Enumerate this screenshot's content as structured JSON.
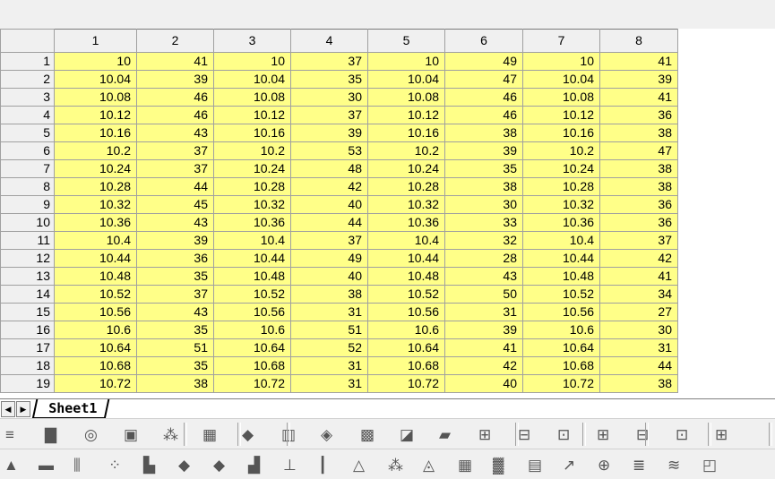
{
  "sheet": {
    "columns": [
      "1",
      "2",
      "3",
      "4",
      "5",
      "6",
      "7",
      "8"
    ],
    "rows": [
      {
        "n": "1",
        "v": [
          "10",
          "41",
          "10",
          "37",
          "10",
          "49",
          "10",
          "41"
        ]
      },
      {
        "n": "2",
        "v": [
          "10.04",
          "39",
          "10.04",
          "35",
          "10.04",
          "47",
          "10.04",
          "39"
        ]
      },
      {
        "n": "3",
        "v": [
          "10.08",
          "46",
          "10.08",
          "30",
          "10.08",
          "46",
          "10.08",
          "41"
        ]
      },
      {
        "n": "4",
        "v": [
          "10.12",
          "46",
          "10.12",
          "37",
          "10.12",
          "46",
          "10.12",
          "36"
        ]
      },
      {
        "n": "5",
        "v": [
          "10.16",
          "43",
          "10.16",
          "39",
          "10.16",
          "38",
          "10.16",
          "38"
        ]
      },
      {
        "n": "6",
        "v": [
          "10.2",
          "37",
          "10.2",
          "53",
          "10.2",
          "39",
          "10.2",
          "47"
        ]
      },
      {
        "n": "7",
        "v": [
          "10.24",
          "37",
          "10.24",
          "48",
          "10.24",
          "35",
          "10.24",
          "38"
        ]
      },
      {
        "n": "8",
        "v": [
          "10.28",
          "44",
          "10.28",
          "42",
          "10.28",
          "38",
          "10.28",
          "38"
        ]
      },
      {
        "n": "9",
        "v": [
          "10.32",
          "45",
          "10.32",
          "40",
          "10.32",
          "30",
          "10.32",
          "36"
        ]
      },
      {
        "n": "10",
        "v": [
          "10.36",
          "43",
          "10.36",
          "44",
          "10.36",
          "33",
          "10.36",
          "36"
        ]
      },
      {
        "n": "11",
        "v": [
          "10.4",
          "39",
          "10.4",
          "37",
          "10.4",
          "32",
          "10.4",
          "37"
        ]
      },
      {
        "n": "12",
        "v": [
          "10.44",
          "36",
          "10.44",
          "49",
          "10.44",
          "28",
          "10.44",
          "42"
        ]
      },
      {
        "n": "13",
        "v": [
          "10.48",
          "35",
          "10.48",
          "40",
          "10.48",
          "43",
          "10.48",
          "41"
        ]
      },
      {
        "n": "14",
        "v": [
          "10.52",
          "37",
          "10.52",
          "38",
          "10.52",
          "50",
          "10.52",
          "34"
        ]
      },
      {
        "n": "15",
        "v": [
          "10.56",
          "43",
          "10.56",
          "31",
          "10.56",
          "31",
          "10.56",
          "27"
        ]
      },
      {
        "n": "16",
        "v": [
          "10.6",
          "35",
          "10.6",
          "51",
          "10.6",
          "39",
          "10.6",
          "30"
        ]
      },
      {
        "n": "17",
        "v": [
          "10.64",
          "51",
          "10.64",
          "52",
          "10.64",
          "41",
          "10.64",
          "31"
        ]
      },
      {
        "n": "18",
        "v": [
          "10.68",
          "35",
          "10.68",
          "31",
          "10.68",
          "42",
          "10.68",
          "44"
        ]
      },
      {
        "n": "19",
        "v": [
          "10.72",
          "38",
          "10.72",
          "31",
          "10.72",
          "40",
          "10.72",
          "38"
        ]
      }
    ]
  },
  "tabs": {
    "nav_prev": "◀",
    "nav_next": "▶",
    "active_sheet": "Sheet1"
  },
  "toolbar1": [
    {
      "name": "line-plot-icon",
      "glyph": "≡"
    },
    {
      "name": "column-plot-icon",
      "glyph": "▇"
    },
    {
      "name": "pie-plot-icon",
      "glyph": "◎"
    },
    {
      "name": "box-plot-icon",
      "glyph": "▣"
    },
    {
      "name": "3d-scatter-icon",
      "glyph": "⁂"
    },
    {
      "name": "3d-bar-icon",
      "glyph": "▦"
    },
    {
      "name": "3d-surface-blue-icon",
      "glyph": "◆"
    },
    {
      "name": "3d-bars-color-icon",
      "glyph": "▥"
    },
    {
      "name": "3d-wireframe-icon",
      "glyph": "◈"
    },
    {
      "name": "contour-color-icon",
      "glyph": "▩"
    },
    {
      "name": "image-plot-icon",
      "glyph": "◪"
    },
    {
      "name": "profile-plot-icon",
      "glyph": "▰"
    },
    {
      "name": "layout-icon-1",
      "glyph": "⊞"
    },
    {
      "name": "layout-icon-2",
      "glyph": "⊟"
    },
    {
      "name": "layout-icon-3",
      "glyph": "⊡"
    },
    {
      "name": "layout-icon-4",
      "glyph": "⊞"
    },
    {
      "name": "layout-icon-5",
      "glyph": "⊟"
    },
    {
      "name": "layout-icon-6",
      "glyph": "⊡"
    },
    {
      "name": "layout-icon-7",
      "glyph": "⊞"
    }
  ],
  "toolbar2": [
    {
      "name": "area-plot-icon",
      "glyph": "▲"
    },
    {
      "name": "stack-plot-icon",
      "glyph": "▬"
    },
    {
      "name": "error-bar-icon",
      "glyph": "⫼"
    },
    {
      "name": "scatter-icon",
      "glyph": "⁘"
    },
    {
      "name": "step-plot-icon",
      "glyph": "▙"
    },
    {
      "name": "3d-ribbon-icon",
      "glyph": "◆"
    },
    {
      "name": "3d-wall-icon",
      "glyph": "◆"
    },
    {
      "name": "column-stack-icon",
      "glyph": "▟"
    },
    {
      "name": "floating-bar-icon",
      "glyph": "⊥"
    },
    {
      "name": "hi-lo-icon",
      "glyph": "┃"
    },
    {
      "name": "ternary-icon",
      "glyph": "△"
    },
    {
      "name": "triangle-icon",
      "glyph": "⁂"
    },
    {
      "name": "polar-icon",
      "glyph": "◬"
    },
    {
      "name": "multi-panel-icon",
      "glyph": "▦"
    },
    {
      "name": "bubble-color-icon",
      "glyph": "▓"
    },
    {
      "name": "waterfall-icon",
      "glyph": "▤"
    },
    {
      "name": "vector-icon",
      "glyph": "↗"
    },
    {
      "name": "zoom-icon",
      "glyph": "⊕"
    },
    {
      "name": "stack-lines-icon",
      "glyph": "≣"
    },
    {
      "name": "stack-bars-icon",
      "glyph": "≋"
    },
    {
      "name": "template-icon",
      "glyph": "◰"
    }
  ]
}
